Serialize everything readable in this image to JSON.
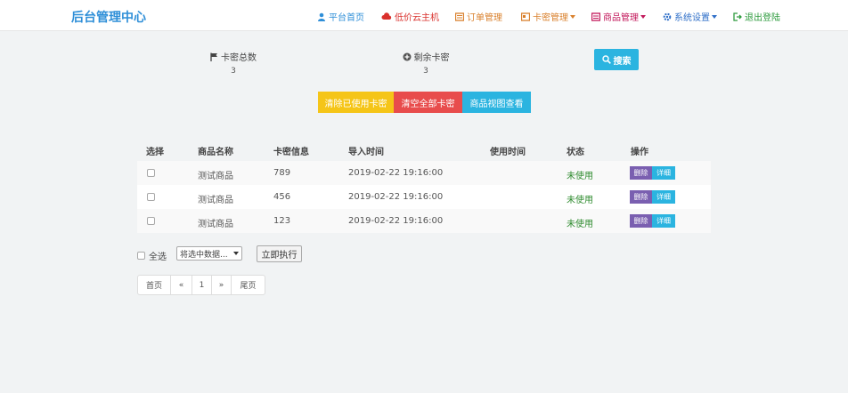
{
  "nav": {
    "brand": "后台管理中心",
    "items": [
      {
        "label": "平台首页",
        "color": "#2f8fd8"
      },
      {
        "label": "低价云主机",
        "color": "#d9302c"
      },
      {
        "label": "订单管理",
        "color": "#d9802c"
      },
      {
        "label": "卡密管理",
        "color": "#d9802c"
      },
      {
        "label": "商品管理",
        "color": "#c2185b"
      },
      {
        "label": "系统设置",
        "color": "#2f6fc8"
      },
      {
        "label": "退出登陆",
        "color": "#2e9b3e"
      }
    ]
  },
  "stats": {
    "total_label": "卡密总数",
    "total_value": "3",
    "remain_label": "剩余卡密",
    "remain_value": "3"
  },
  "search_label": "搜索",
  "actions": {
    "clear_used": "清除已使用卡密",
    "clear_all": "清空全部卡密",
    "view_goods": "商品视图查看"
  },
  "table": {
    "headers": [
      "选择",
      "商品名称",
      "卡密信息",
      "导入时间",
      "使用时间",
      "状态",
      "操作"
    ],
    "rows": [
      {
        "name": "测试商品",
        "card": "789",
        "import_time": "2019-02-22 19:16:00",
        "use_time": "",
        "status": "未使用",
        "delete": "删除",
        "detail": "详细"
      },
      {
        "name": "测试商品",
        "card": "456",
        "import_time": "2019-02-22 19:16:00",
        "use_time": "",
        "status": "未使用",
        "delete": "删除",
        "detail": "详细"
      },
      {
        "name": "测试商品",
        "card": "123",
        "import_time": "2019-02-22 19:16:00",
        "use_time": "",
        "status": "未使用",
        "delete": "删除",
        "detail": "详细"
      }
    ]
  },
  "bulk": {
    "select_all": "全选",
    "dropdown": "将选中数据...",
    "execute": "立即执行"
  },
  "pager": {
    "first": "首页",
    "prev": "«",
    "page": "1",
    "next": "»",
    "last": "尾页"
  },
  "colors": {
    "accent": "#2f8fd8",
    "yellow_btn": "#f5c518",
    "red_btn": "#e84c4c",
    "cyan_btn": "#2bb4e0",
    "delete_tag": "#7a5fb0",
    "detail_tag": "#2bb4e0",
    "status_green": "#2e8b2e"
  }
}
